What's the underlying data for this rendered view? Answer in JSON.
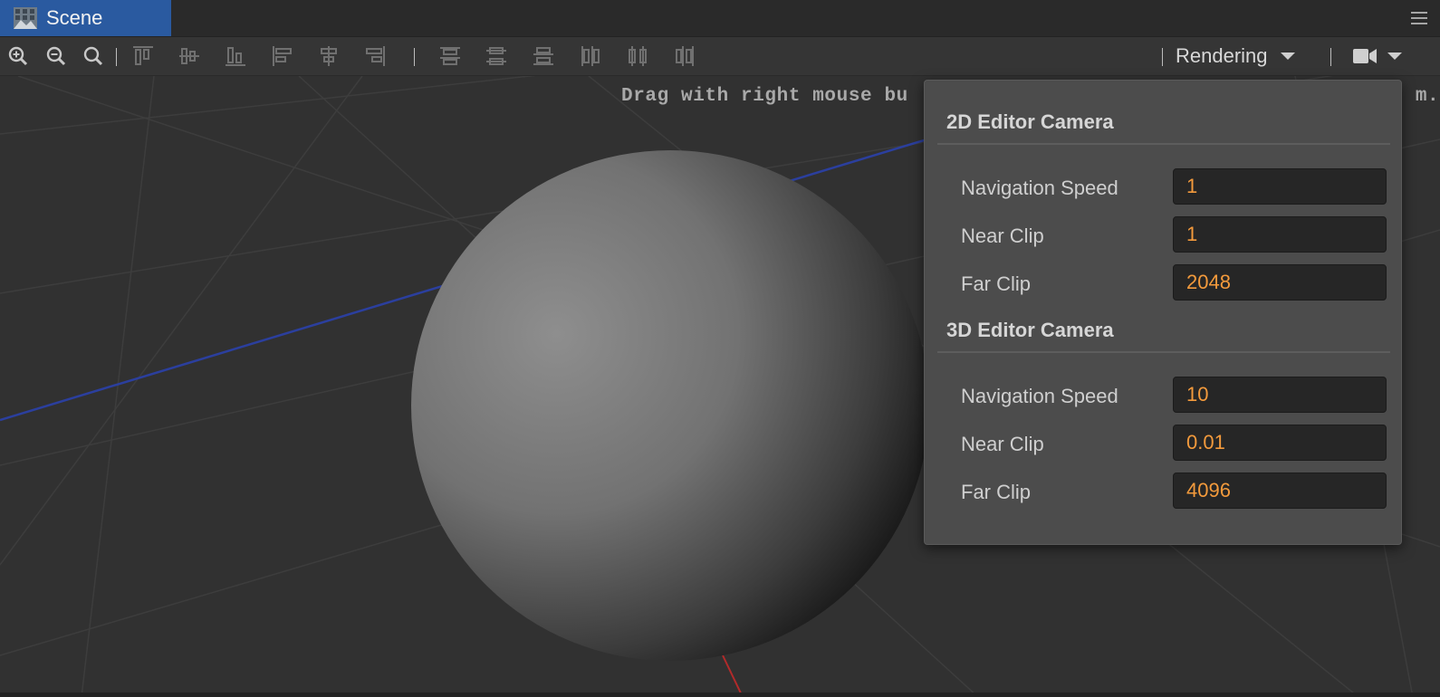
{
  "tab": {
    "title": "Scene",
    "icon": "scene-grid-icon"
  },
  "toolbar": {
    "zoom_icons": [
      "zoom-in-icon",
      "zoom-out-icon",
      "zoom-reset-icon"
    ],
    "align_icons": [
      "align-top-icon",
      "align-vertical-center-icon",
      "align-bottom-icon",
      "align-left-icon",
      "align-horizontal-center-icon",
      "align-right-icon"
    ],
    "distribute_icons": [
      "distribute-top-icon",
      "distribute-vertical-center-icon",
      "distribute-bottom-icon",
      "distribute-left-icon",
      "distribute-horizontal-center-icon",
      "distribute-right-icon"
    ],
    "rendering_label": "Rendering",
    "camera_icon": "video-camera-icon"
  },
  "viewport": {
    "hint_visible": "Drag with right mouse bu",
    "hint_tail": "m."
  },
  "camera_popup": {
    "sections": [
      {
        "title": "2D Editor Camera",
        "fields": [
          {
            "label": "Navigation Speed",
            "value": "1"
          },
          {
            "label": "Near Clip",
            "value": "1"
          },
          {
            "label": "Far Clip",
            "value": "2048"
          }
        ]
      },
      {
        "title": "3D Editor Camera",
        "fields": [
          {
            "label": "Navigation Speed",
            "value": "10"
          },
          {
            "label": "Near Clip",
            "value": "0.01"
          },
          {
            "label": "Far Clip",
            "value": "4096"
          }
        ]
      }
    ]
  },
  "colors": {
    "tab_active": "#2a5aa0",
    "value_text": "#f39a3c",
    "axis_blue": "#2b3f9e",
    "axis_red": "#b22a2a"
  }
}
